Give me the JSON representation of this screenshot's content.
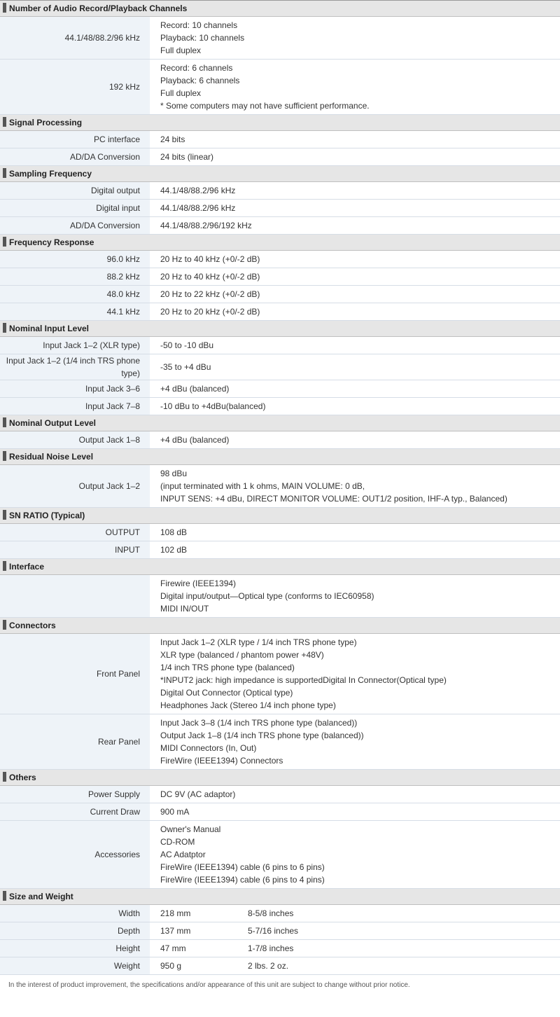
{
  "sections": [
    {
      "title": "Number of Audio Record/Playback Channels",
      "rows": [
        {
          "label": "44.1/48/88.2/96 kHz",
          "value": [
            "Record: 10 channels",
            "Playback: 10 channels",
            "Full duplex"
          ]
        },
        {
          "label": "192 kHz",
          "value": [
            "Record: 6 channels",
            "Playback: 6 channels",
            "Full duplex",
            "* Some computers may not have sufficient performance."
          ]
        }
      ]
    },
    {
      "title": "Signal Processing",
      "rows": [
        {
          "label": "PC interface",
          "value": [
            "24 bits"
          ]
        },
        {
          "label": "AD/DA Conversion",
          "value": [
            "24 bits (linear)"
          ]
        }
      ]
    },
    {
      "title": "Sampling Frequency",
      "rows": [
        {
          "label": "Digital output",
          "value": [
            "44.1/48/88.2/96 kHz"
          ]
        },
        {
          "label": "Digital input",
          "value": [
            "44.1/48/88.2/96 kHz"
          ]
        },
        {
          "label": "AD/DA Conversion",
          "value": [
            "44.1/48/88.2/96/192 kHz"
          ]
        }
      ]
    },
    {
      "title": "Frequency Response",
      "rows": [
        {
          "label": "96.0 kHz",
          "value": [
            "20 Hz to 40 kHz (+0/-2 dB)"
          ]
        },
        {
          "label": "88.2 kHz",
          "value": [
            "20 Hz to 40 kHz (+0/-2 dB)"
          ]
        },
        {
          "label": "48.0 kHz",
          "value": [
            "20 Hz to 22 kHz (+0/-2 dB)"
          ]
        },
        {
          "label": "44.1 kHz",
          "value": [
            "20 Hz to 20 kHz (+0/-2 dB)"
          ]
        }
      ]
    },
    {
      "title": "Nominal Input Level",
      "rows": [
        {
          "label": "Input Jack 1–2 (XLR type)",
          "value": [
            "-50 to -10 dBu"
          ]
        },
        {
          "label": "Input Jack 1–2 (1/4 inch TRS phone type)",
          "value": [
            "-35 to +4 dBu"
          ]
        },
        {
          "label": "Input Jack 3–6",
          "value": [
            "+4 dBu (balanced)"
          ]
        },
        {
          "label": "Input Jack 7–8",
          "value": [
            "-10 dBu to +4dBu(balanced)"
          ]
        }
      ]
    },
    {
      "title": "Nominal Output Level",
      "rows": [
        {
          "label": "Output Jack 1–8",
          "value": [
            "+4 dBu (balanced)"
          ]
        }
      ]
    },
    {
      "title": "Residual Noise Level",
      "rows": [
        {
          "label": "Output Jack 1–2",
          "value": [
            "98 dBu",
            "(input terminated with 1 k ohms, MAIN VOLUME: 0 dB,",
            "INPUT SENS: +4 dBu, DIRECT MONITOR VOLUME: OUT1/2 position, IHF-A typ., Balanced)"
          ]
        }
      ]
    },
    {
      "title": "SN RATIO (Typical)",
      "rows": [
        {
          "label": "OUTPUT",
          "value": [
            "108 dB"
          ]
        },
        {
          "label": "INPUT",
          "value": [
            "102 dB"
          ]
        }
      ]
    },
    {
      "title": "Interface",
      "rows": [
        {
          "label": "",
          "value": [
            "Firewire (IEEE1394)",
            "Digital input/output—Optical type (conforms to IEC60958)",
            "MIDI IN/OUT"
          ]
        }
      ]
    },
    {
      "title": "Connectors",
      "rows": [
        {
          "label": "Front Panel",
          "value": [
            "Input Jack 1–2 (XLR type / 1/4 inch TRS phone type)",
            "XLR type (balanced / phantom power +48V)",
            "1/4 inch TRS phone type (balanced)",
            "*INPUT2 jack: high impedance is supportedDigital In Connector(Optical type)",
            "Digital Out Connector (Optical type)",
            "Headphones Jack (Stereo 1/4 inch phone type)"
          ]
        },
        {
          "label": "Rear Panel",
          "value": [
            "Input Jack 3–8 (1/4 inch TRS phone type (balanced))",
            "Output Jack 1–8 (1/4 inch TRS phone type (balanced))",
            "MIDI Connectors (In, Out)",
            "FireWire (IEEE1394) Connectors"
          ]
        }
      ]
    },
    {
      "title": "Others",
      "rows": [
        {
          "label": "Power Supply",
          "value": [
            "DC 9V (AC adaptor)"
          ]
        },
        {
          "label": "Current Draw",
          "value": [
            "900 mA"
          ]
        },
        {
          "label": "Accessories",
          "value": [
            "Owner's Manual",
            "CD-ROM",
            "AC Adatptor",
            "FireWire (IEEE1394) cable (6 pins to 6 pins)",
            "FireWire (IEEE1394) cable (6 pins to 4 pins)"
          ]
        }
      ]
    },
    {
      "title": "Size and Weight",
      "rows": [
        {
          "label": "Width",
          "value": [
            "218 mm"
          ],
          "value2": "8-5/8 inches"
        },
        {
          "label": "Depth",
          "value": [
            "137 mm"
          ],
          "value2": "5-7/16 inches"
        },
        {
          "label": "Height",
          "value": [
            "47 mm"
          ],
          "value2": "1-7/8 inches"
        },
        {
          "label": "Weight",
          "value": [
            "950 g"
          ],
          "value2": "2 lbs. 2 oz."
        }
      ]
    }
  ],
  "footer_note": "In the interest of product improvement, the specifications and/or appearance of this unit are subject to change without prior notice."
}
